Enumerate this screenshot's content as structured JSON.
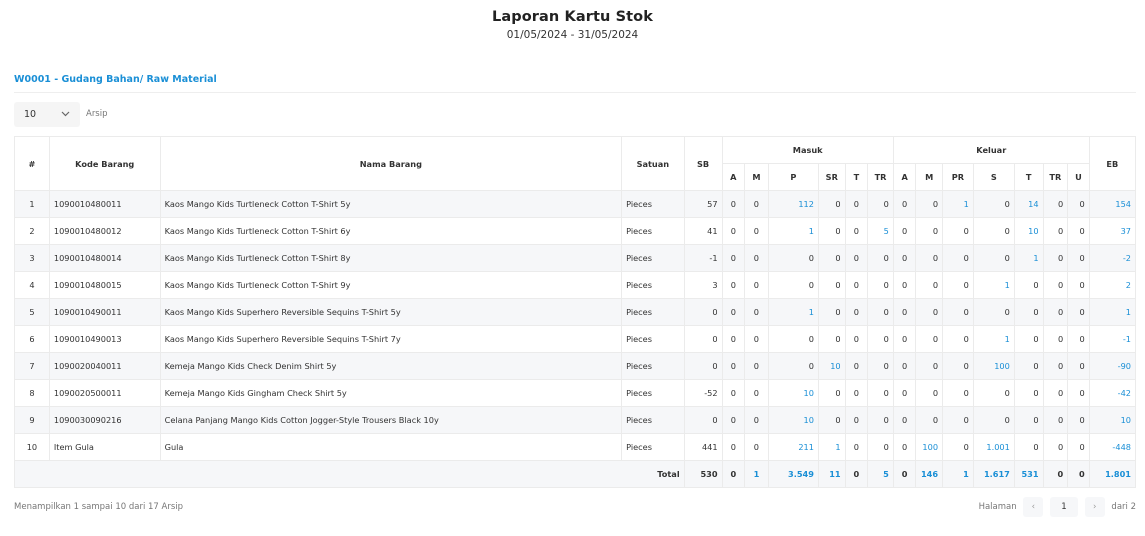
{
  "report": {
    "title": "Laporan Kartu Stok",
    "period": "01/05/2024 - 31/05/2024"
  },
  "warehouse": {
    "title": "W0001 - Gudang Bahan/ Raw Material"
  },
  "controls": {
    "page_size": "10",
    "page_size_label": "Arsip",
    "chevron_icon": "chevron-down-icon"
  },
  "table": {
    "headers": {
      "no": "#",
      "code": "Kode Barang",
      "name": "Nama Barang",
      "unit": "Satuan",
      "sb": "SB",
      "masuk": "Masuk",
      "keluar": "Keluar",
      "eb": "EB",
      "masuk_cols": [
        "A",
        "M",
        "P",
        "SR",
        "T",
        "TR"
      ],
      "keluar_cols": [
        "A",
        "M",
        "PR",
        "S",
        "T",
        "TR",
        "U"
      ]
    },
    "rows": [
      {
        "no": "1",
        "code": "1090010480011",
        "name": "Kaos Mango Kids Turtleneck Cotton T-Shirt 5y",
        "unit": "Pieces",
        "sb": "57",
        "m_a": "0",
        "m_m": "0",
        "m_p": "112",
        "m_sr": "0",
        "m_t": "0",
        "m_tr": "0",
        "k_a": "0",
        "k_m": "0",
        "k_pr": "1",
        "k_s": "0",
        "k_t": "14",
        "k_tr": "0",
        "k_u": "0",
        "eb": "154"
      },
      {
        "no": "2",
        "code": "1090010480012",
        "name": "Kaos Mango Kids Turtleneck Cotton T-Shirt 6y",
        "unit": "Pieces",
        "sb": "41",
        "m_a": "0",
        "m_m": "0",
        "m_p": "1",
        "m_sr": "0",
        "m_t": "0",
        "m_tr": "5",
        "k_a": "0",
        "k_m": "0",
        "k_pr": "0",
        "k_s": "0",
        "k_t": "10",
        "k_tr": "0",
        "k_u": "0",
        "eb": "37"
      },
      {
        "no": "3",
        "code": "1090010480014",
        "name": "Kaos Mango Kids Turtleneck Cotton T-Shirt 8y",
        "unit": "Pieces",
        "sb": "-1",
        "m_a": "0",
        "m_m": "0",
        "m_p": "0",
        "m_sr": "0",
        "m_t": "0",
        "m_tr": "0",
        "k_a": "0",
        "k_m": "0",
        "k_pr": "0",
        "k_s": "0",
        "k_t": "1",
        "k_tr": "0",
        "k_u": "0",
        "eb": "-2"
      },
      {
        "no": "4",
        "code": "1090010480015",
        "name": "Kaos Mango Kids Turtleneck Cotton T-Shirt 9y",
        "unit": "Pieces",
        "sb": "3",
        "m_a": "0",
        "m_m": "0",
        "m_p": "0",
        "m_sr": "0",
        "m_t": "0",
        "m_tr": "0",
        "k_a": "0",
        "k_m": "0",
        "k_pr": "0",
        "k_s": "1",
        "k_t": "0",
        "k_tr": "0",
        "k_u": "0",
        "eb": "2"
      },
      {
        "no": "5",
        "code": "1090010490011",
        "name": "Kaos Mango Kids Superhero Reversible Sequins T-Shirt 5y",
        "unit": "Pieces",
        "sb": "0",
        "m_a": "0",
        "m_m": "0",
        "m_p": "1",
        "m_sr": "0",
        "m_t": "0",
        "m_tr": "0",
        "k_a": "0",
        "k_m": "0",
        "k_pr": "0",
        "k_s": "0",
        "k_t": "0",
        "k_tr": "0",
        "k_u": "0",
        "eb": "1"
      },
      {
        "no": "6",
        "code": "1090010490013",
        "name": "Kaos Mango Kids Superhero Reversible Sequins T-Shirt 7y",
        "unit": "Pieces",
        "sb": "0",
        "m_a": "0",
        "m_m": "0",
        "m_p": "0",
        "m_sr": "0",
        "m_t": "0",
        "m_tr": "0",
        "k_a": "0",
        "k_m": "0",
        "k_pr": "0",
        "k_s": "1",
        "k_t": "0",
        "k_tr": "0",
        "k_u": "0",
        "eb": "-1"
      },
      {
        "no": "7",
        "code": "1090020040011",
        "name": "Kemeja Mango Kids Check Denim Shirt 5y",
        "unit": "Pieces",
        "sb": "0",
        "m_a": "0",
        "m_m": "0",
        "m_p": "0",
        "m_sr": "10",
        "m_t": "0",
        "m_tr": "0",
        "k_a": "0",
        "k_m": "0",
        "k_pr": "0",
        "k_s": "100",
        "k_t": "0",
        "k_tr": "0",
        "k_u": "0",
        "eb": "-90"
      },
      {
        "no": "8",
        "code": "1090020500011",
        "name": "Kemeja Mango Kids Gingham Check Shirt 5y",
        "unit": "Pieces",
        "sb": "-52",
        "m_a": "0",
        "m_m": "0",
        "m_p": "10",
        "m_sr": "0",
        "m_t": "0",
        "m_tr": "0",
        "k_a": "0",
        "k_m": "0",
        "k_pr": "0",
        "k_s": "0",
        "k_t": "0",
        "k_tr": "0",
        "k_u": "0",
        "eb": "-42"
      },
      {
        "no": "9",
        "code": "1090030090216",
        "name": "Celana Panjang Mango Kids Cotton Jogger-Style Trousers Black 10y",
        "unit": "Pieces",
        "sb": "0",
        "m_a": "0",
        "m_m": "0",
        "m_p": "10",
        "m_sr": "0",
        "m_t": "0",
        "m_tr": "0",
        "k_a": "0",
        "k_m": "0",
        "k_pr": "0",
        "k_s": "0",
        "k_t": "0",
        "k_tr": "0",
        "k_u": "0",
        "eb": "10"
      },
      {
        "no": "10",
        "code": "Item Gula",
        "name": "Gula",
        "unit": "Pieces",
        "sb": "441",
        "m_a": "0",
        "m_m": "0",
        "m_p": "211",
        "m_sr": "1",
        "m_t": "0",
        "m_tr": "0",
        "k_a": "0",
        "k_m": "100",
        "k_pr": "0",
        "k_s": "1.001",
        "k_t": "0",
        "k_tr": "0",
        "k_u": "0",
        "eb": "-448"
      }
    ],
    "totals": {
      "label": "Total",
      "sb": "530",
      "m_a": "0",
      "m_m": "1",
      "m_p": "3.549",
      "m_sr": "11",
      "m_t": "0",
      "m_tr": "5",
      "k_a": "0",
      "k_m": "146",
      "k_pr": "1",
      "k_s": "1.617",
      "k_t": "531",
      "k_tr": "0",
      "k_u": "0",
      "eb": "1.801"
    }
  },
  "footer": {
    "info": "Menampilkan 1 sampai 10 dari 17 Arsip",
    "halaman_label": "Halaman",
    "prev_icon": "‹",
    "current_page": "1",
    "next_icon": "›",
    "of_label": "dari 2"
  },
  "colors": {
    "accent": "#1a8fd6",
    "row_stripe": "#f6f7f9"
  }
}
